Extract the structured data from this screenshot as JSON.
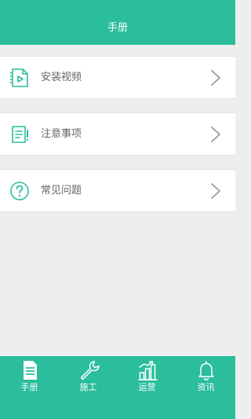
{
  "header": {
    "title": "手册"
  },
  "menu": {
    "items": [
      {
        "label": "安装视频",
        "icon": "video-file-icon"
      },
      {
        "label": "注意事项",
        "icon": "notice-document-icon"
      },
      {
        "label": "常见问题",
        "icon": "question-circle-icon"
      }
    ]
  },
  "tabbar": {
    "tabs": [
      {
        "label": "手册",
        "icon": "manual-document-icon",
        "active": true
      },
      {
        "label": "施工",
        "icon": "wrench-icon",
        "active": false
      },
      {
        "label": "运营",
        "icon": "growth-chart-icon",
        "active": false
      },
      {
        "label": "资讯",
        "icon": "bell-icon",
        "active": false
      }
    ]
  },
  "colors": {
    "brand": "#2bbd9c",
    "background": "#eeeeee",
    "text": "#666666",
    "chevron": "#999999"
  }
}
